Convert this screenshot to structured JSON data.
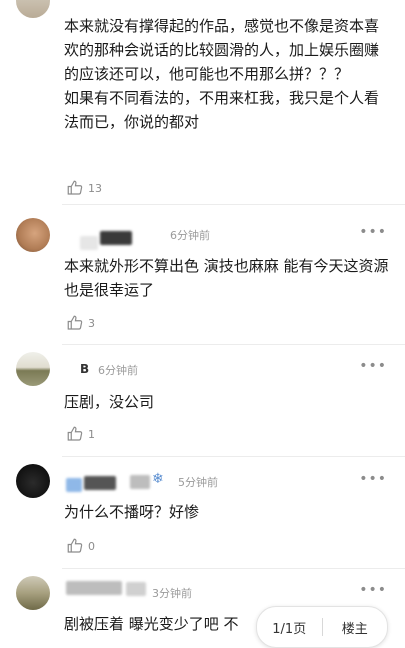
{
  "comments": [
    {
      "text": "本来就没有撑得起的作品，感觉也不像是资本喜欢的那种会说话的比较圆滑的人，加上娱乐圈赚的应该还可以，他可能也不用那么拼？？？\n如果有不同看法的，不用来杠我，我只是个人看法而已，你说的都对",
      "likes": "13"
    },
    {
      "time": "6分钟前",
      "text": "本来就外形不算出色 演技也麻麻 能有今天这资源也是很幸运了",
      "likes": "3"
    },
    {
      "badge": "B",
      "time": "6分钟前",
      "text": "压剧，没公司",
      "likes": "1"
    },
    {
      "time": "5分钟前",
      "text": "为什么不播呀？好惨",
      "likes": "0"
    },
    {
      "time": "3分钟前",
      "text": "剧被压着 曝光变少了吧 不"
    }
  ],
  "more_label": "•••",
  "pager": {
    "page": "1/1页",
    "owner": "楼主"
  }
}
